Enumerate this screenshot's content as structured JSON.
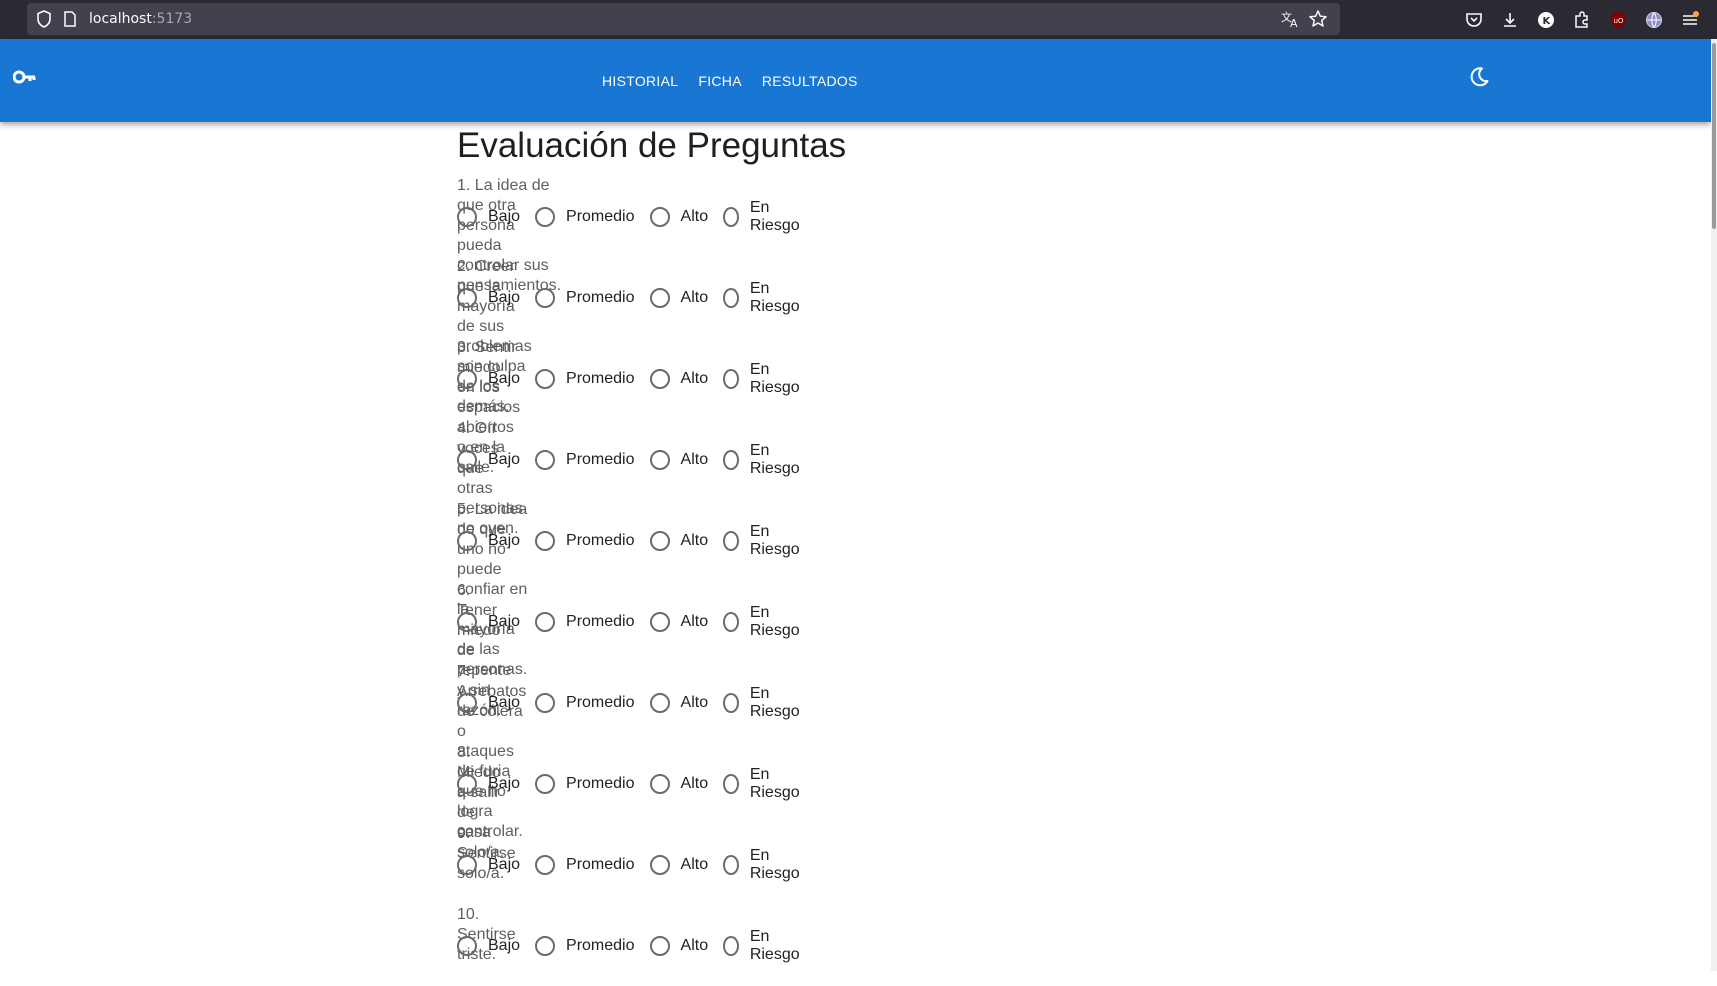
{
  "browser": {
    "url_host": "localhost",
    "url_port": ":5173"
  },
  "nav": {
    "items": [
      "HISTORIAL",
      "FICHA",
      "RESULTADOS"
    ]
  },
  "page": {
    "title": "Evaluación de Preguntas"
  },
  "options": [
    "Bajo",
    "Promedio",
    "Alto",
    "En Riesgo"
  ],
  "questions": [
    "1. La idea de que otra persona pueda controlar sus pensamientos.",
    "2. Creer que la mayoría de sus problemas son culpa de los demás.",
    "3. Sentir miedo en los espacios abiertos o en la calle.",
    "4. Oír voces que otras personas no oyen.",
    "5. La idea de que uno no puede confiar en la mayoría de las personas.",
    "6. Tener miedo de repente y sin razón.",
    "7. Arrebatos de cólera o ataques de furia que no logra controlar.",
    "8. Miedo a salir de casa solo/a.",
    "9. Sentirse solo/a.",
    "10. Sentirse triste."
  ],
  "colors": {
    "appbar": "#1976d2",
    "browser_chrome": "#2b2a33"
  }
}
